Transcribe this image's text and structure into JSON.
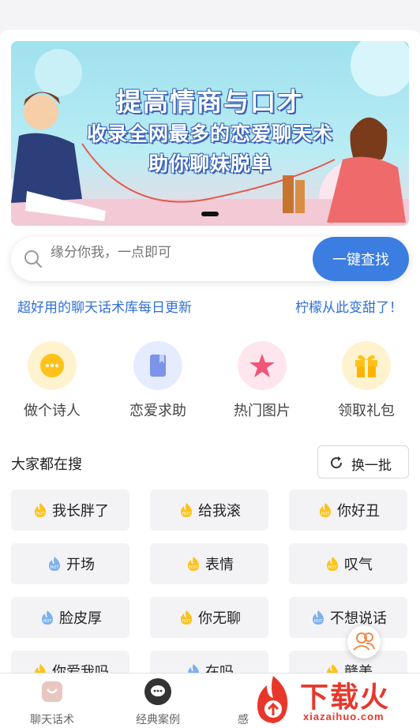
{
  "banner": {
    "line1": "提高情商与口才",
    "line2": "收录全网最多的恋爱聊天术",
    "line3": "助你聊妹脱单"
  },
  "search": {
    "placeholder": "缘分你我，一点即可",
    "button_label": "一键查找"
  },
  "promo": {
    "left": "超好用的聊天话术库每日更新",
    "right": "柠檬从此变甜了！"
  },
  "quick_actions": [
    {
      "label": "做个诗人",
      "icon": "chat-bubble-icon"
    },
    {
      "label": "恋爱求助",
      "icon": "book-icon"
    },
    {
      "label": "热门图片",
      "icon": "star-icon"
    },
    {
      "label": "领取礼包",
      "icon": "gift-icon"
    }
  ],
  "trending": {
    "title": "大家都在搜",
    "refresh_label": "换一批",
    "tags": [
      {
        "text": "我长胖了",
        "hot": "yellow"
      },
      {
        "text": "给我滚",
        "hot": "yellow"
      },
      {
        "text": "你好丑",
        "hot": "yellow"
      },
      {
        "text": "开场",
        "hot": "blue"
      },
      {
        "text": "表情",
        "hot": "yellow"
      },
      {
        "text": "叹气",
        "hot": "yellow"
      },
      {
        "text": "脸皮厚",
        "hot": "blue"
      },
      {
        "text": "你无聊",
        "hot": "yellow"
      },
      {
        "text": "不想说话",
        "hot": "blue"
      },
      {
        "text": "你爱我吗",
        "hot": "yellow"
      },
      {
        "text": "在吗",
        "hot": "blue"
      },
      {
        "text": "赣美",
        "hot": "yellow"
      }
    ]
  },
  "bottom_nav": [
    {
      "label": "聊天话术",
      "icon": "bag-icon"
    },
    {
      "label": "经典案例",
      "icon": "message-icon"
    },
    {
      "label": "感",
      "icon": "heart-icon"
    }
  ],
  "watermark": {
    "text": "下载火",
    "sub": "xiazaihuo.com"
  },
  "colors": {
    "accent": "#3b7de0",
    "promo": "#2f6fd6",
    "tag_bg": "#f3f3f5",
    "watermark": "#e8372a"
  }
}
